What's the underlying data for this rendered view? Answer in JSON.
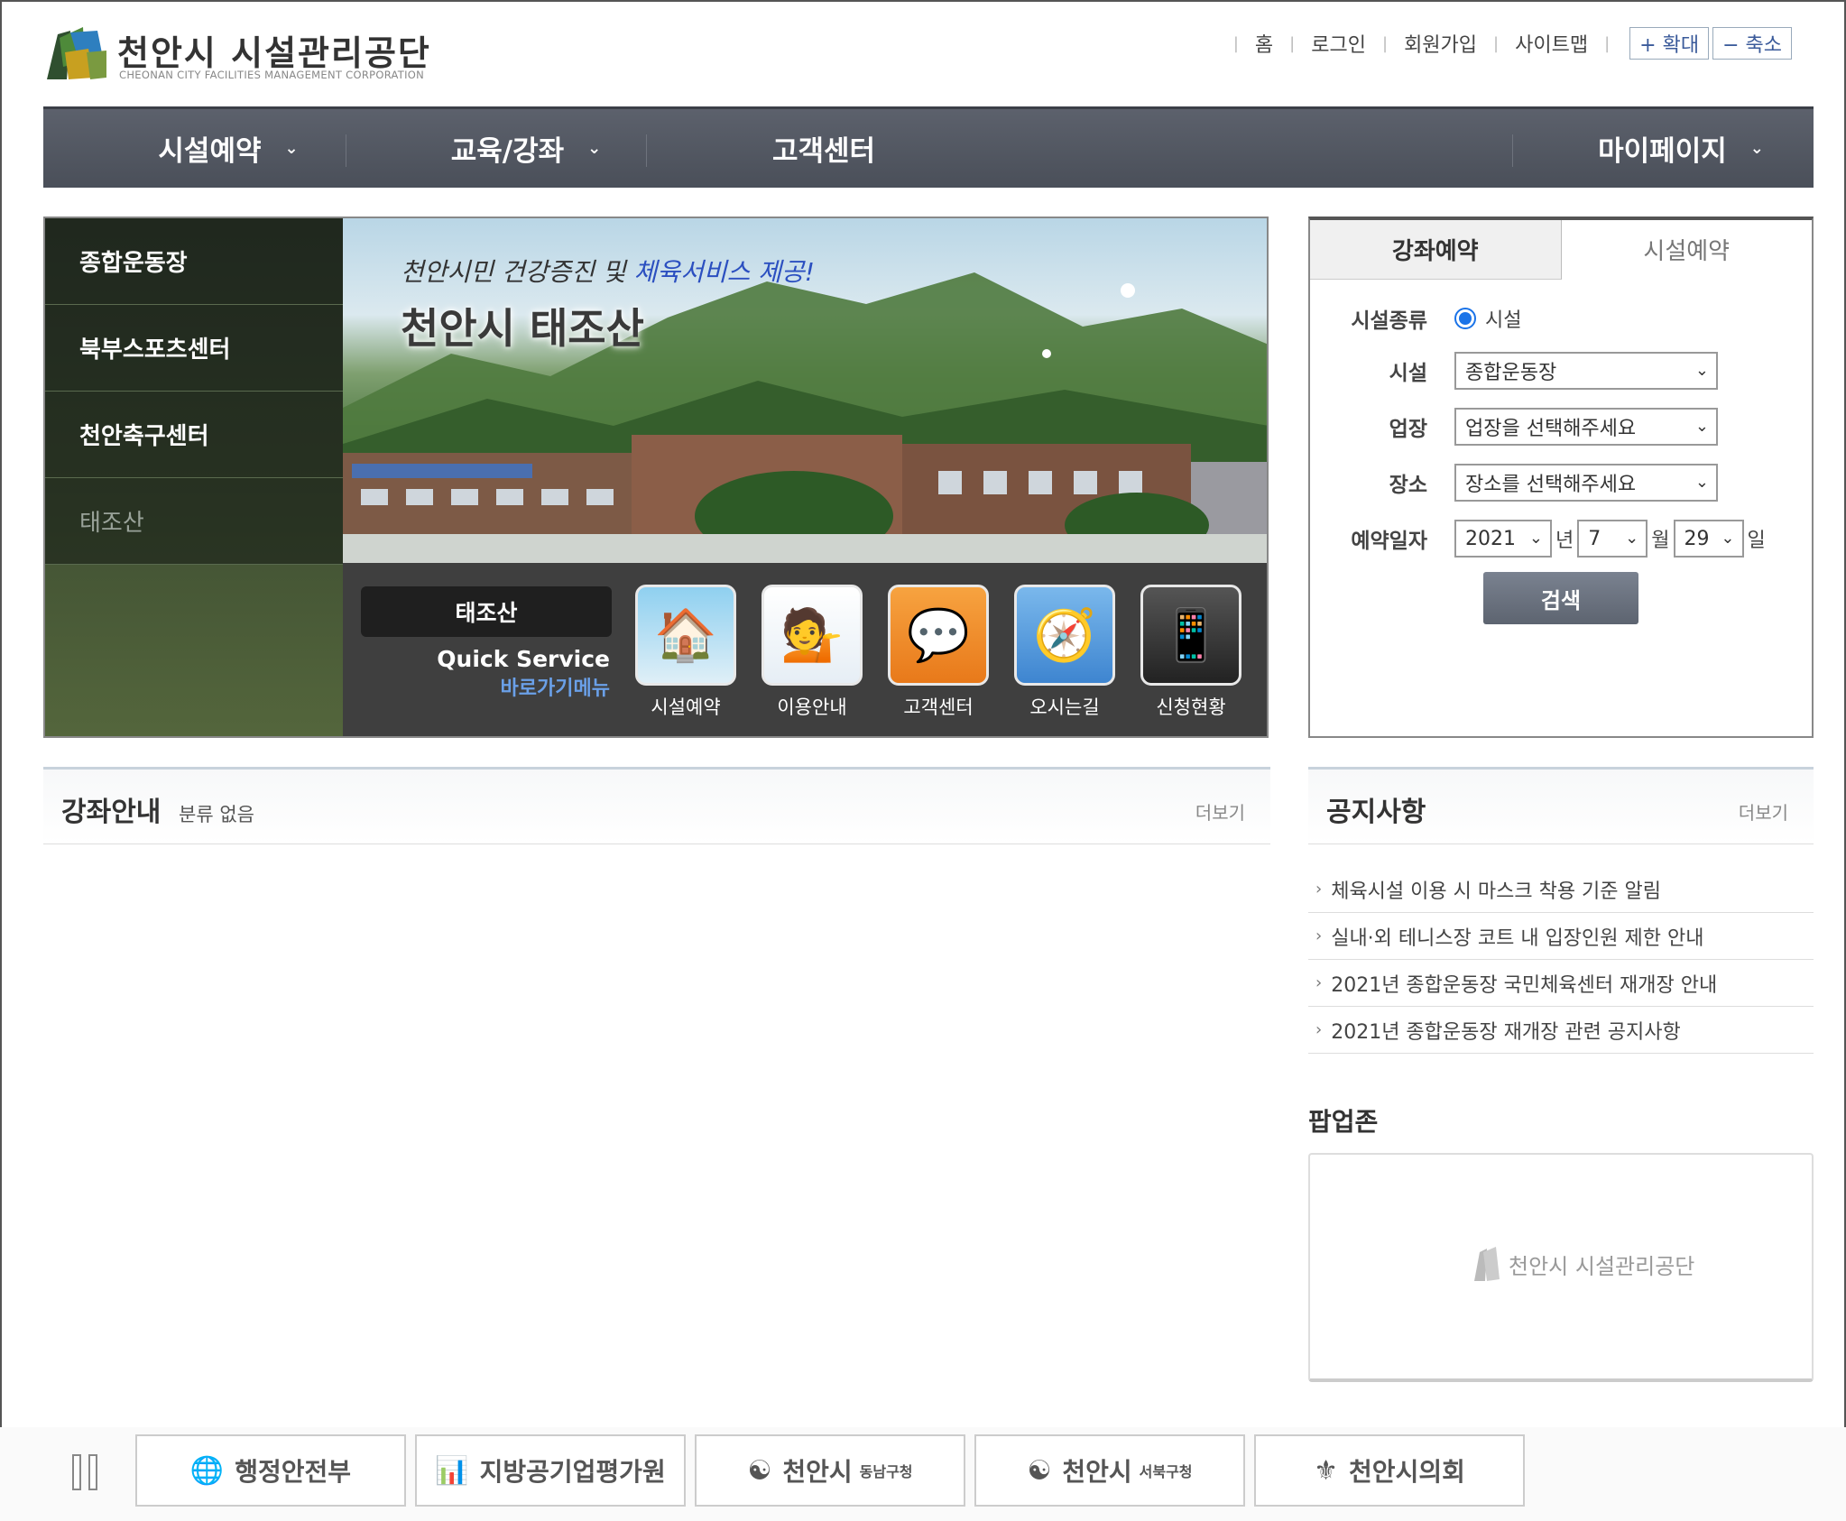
{
  "header": {
    "logo_title": "천안시 시설관리공단",
    "logo_sub": "CHEONAN CITY FACILITIES MANAGEMENT CORPORATION",
    "util_links": [
      "홈",
      "로그인",
      "회원가입",
      "사이트맵"
    ],
    "zoom_in": "+ 확대",
    "zoom_out": "− 축소"
  },
  "nav": {
    "items": [
      "시설예약",
      "교육/강좌",
      "고객센터",
      "마이페이지"
    ]
  },
  "visual": {
    "side_menu": [
      "종합운동장",
      "북부스포츠센터",
      "천안축구센터",
      "태조산"
    ],
    "slogan_a": "천안시민 건강증진 및 ",
    "slogan_b": "체육서비스 제공!",
    "title": "천안시 태조산",
    "quick_label": "태조산",
    "quick_service": "Quick Service",
    "quick_sub": "바로가기메뉴",
    "quick_items": [
      "시설예약",
      "이용안내",
      "고객센터",
      "오시는길",
      "신청현황"
    ]
  },
  "reservation": {
    "tabs": [
      "강좌예약",
      "시설예약"
    ],
    "labels": {
      "type": "시설종류",
      "facility": "시설",
      "venue": "업장",
      "place": "장소",
      "date": "예약일자"
    },
    "radio_label": "시설",
    "facility_value": "종합운동장",
    "venue_value": "업장을 선택해주세요",
    "place_value": "장소를 선택해주세요",
    "year": "2021",
    "year_unit": "년",
    "month": "7",
    "month_unit": "월",
    "day": "29",
    "day_unit": "일",
    "search": "검색"
  },
  "lecture": {
    "title": "강좌안내",
    "sub": "분류 없음",
    "more": "더보기"
  },
  "notice": {
    "title": "공지사항",
    "more": "더보기",
    "items": [
      "체육시설 이용 시 마스크 착용 기준 알림",
      "실내·외 테니스장 코트 내 입장인원 제한 안내",
      "2021년 종합운동장 국민체육센터 재개장 안내",
      "2021년 종합운동장 재개장 관련 공지사항"
    ]
  },
  "popup": {
    "title": "팝업존",
    "logo_text": "천안시 시설관리공단"
  },
  "banners": {
    "items": [
      {
        "name": "행정안전부",
        "small": ""
      },
      {
        "name": "지방공기업평가원",
        "small": ""
      },
      {
        "name": "천안시",
        "small": "동남구청"
      },
      {
        "name": "천안시",
        "small": "서북구청"
      },
      {
        "name": "천안시의회",
        "small": ""
      }
    ]
  }
}
